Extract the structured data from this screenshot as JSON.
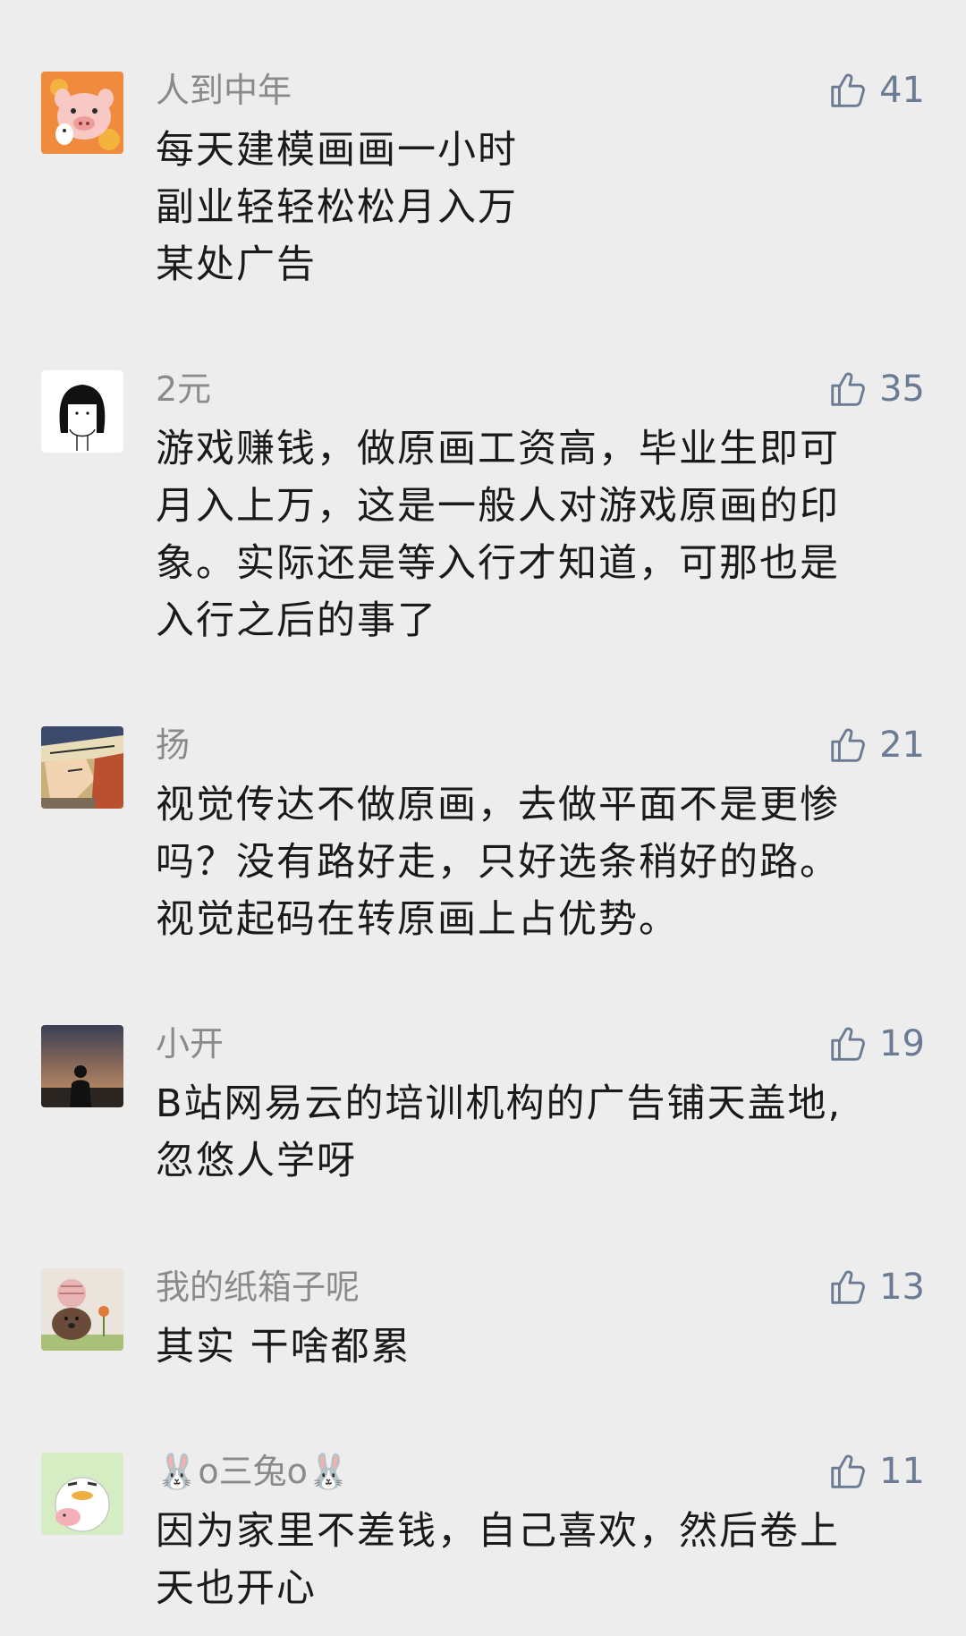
{
  "comments": [
    {
      "name": "人到中年",
      "likes": "41",
      "avatar_icon": "pig-cartoon-avatar",
      "lines": [
        "每天建模画画一小时",
        "副业轻轻松松月入万",
        "某处广告"
      ]
    },
    {
      "name": "2元",
      "likes": "35",
      "avatar_icon": "girl-sketch-avatar",
      "lines": [
        "游戏赚钱，做原画工资高，毕业生即可",
        "月入上万，这是一般人对游戏原画的印",
        "象。实际还是等入行才知道，可那也是",
        "入行之后的事了"
      ]
    },
    {
      "name": "扬",
      "likes": "21",
      "avatar_icon": "anime-boy-avatar",
      "lines": [
        "视觉传达不做原画，去做平面不是更惨",
        "吗？没有路好走，只好选条稍好的路。",
        "视觉起码在转原画上占优势。"
      ]
    },
    {
      "name": "小开",
      "likes": "19",
      "avatar_icon": "sunset-silhouette-avatar",
      "lines": [
        "B站网易云的培训机构的广告铺天盖地,",
        "忽悠人学呀"
      ]
    },
    {
      "name": "我的纸箱子呢",
      "likes": "13",
      "avatar_icon": "dog-with-flower-avatar",
      "lines": [
        "其实 干啥都累"
      ]
    },
    {
      "name": "🐰o三兔o🐰",
      "likes": "11",
      "avatar_icon": "duck-cartoon-avatar",
      "lines": [
        "因为家里不差钱，自己喜欢，然后卷上",
        "天也开心"
      ]
    }
  ],
  "colors": {
    "background": "#ededed",
    "name": "#8a8a8a",
    "text": "#1a1a1a",
    "like": "#6b7b94"
  }
}
